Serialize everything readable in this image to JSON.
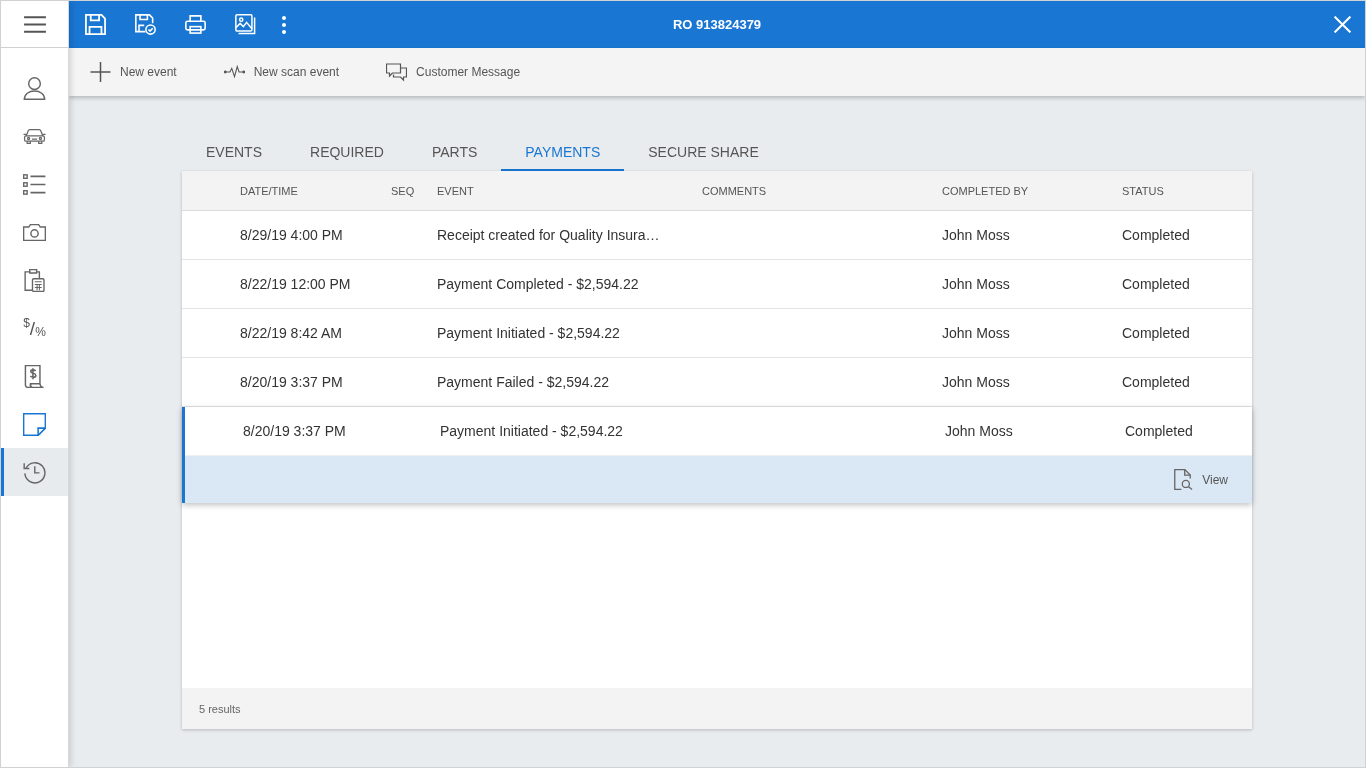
{
  "app_bar": {
    "title": "RO 913824379"
  },
  "sidebar": {
    "items": [
      {
        "kind": "person",
        "selected": false
      },
      {
        "kind": "car",
        "selected": false
      },
      {
        "kind": "checklist",
        "selected": false
      },
      {
        "kind": "camera",
        "selected": false
      },
      {
        "kind": "calculator",
        "selected": false
      },
      {
        "kind": "glyph",
        "text": "$/%",
        "selected": false
      },
      {
        "kind": "receipt",
        "selected": false
      },
      {
        "kind": "note",
        "selected": false
      },
      {
        "kind": "history",
        "selected": true
      }
    ]
  },
  "toolbar": {
    "buttons": [
      {
        "kind": "add",
        "label": "New event"
      },
      {
        "kind": "scan",
        "label": "New scan event"
      },
      {
        "kind": "message",
        "label": "Customer Message"
      }
    ]
  },
  "tabs": [
    {
      "label": "EVENTS",
      "selected": false
    },
    {
      "label": "REQUIRED",
      "selected": false
    },
    {
      "label": "PARTS",
      "selected": false
    },
    {
      "label": "PAYMENTS",
      "selected": true
    },
    {
      "label": "SECURE SHARE",
      "selected": false
    }
  ],
  "table": {
    "columns": [
      "DATE/TIME",
      "SEQ",
      "EVENT",
      "COMMENTS",
      "COMPLETED BY",
      "STATUS"
    ],
    "rows": [
      {
        "date_time": "8/29/19 4:00 PM",
        "event": "Receipt created for Quality Insura…",
        "completed_by": "John Moss",
        "status": "Completed",
        "selected": false,
        "expanded": false
      },
      {
        "date_time": "8/22/19 12:00 PM",
        "event": "Payment Completed - $2,594.22",
        "completed_by": "John Moss",
        "status": "Completed",
        "selected": false,
        "expanded": false
      },
      {
        "date_time": "8/22/19 8:42 AM",
        "event": "Payment Initiated - $2,594.22",
        "completed_by": "John Moss",
        "status": "Completed",
        "selected": false,
        "expanded": false
      },
      {
        "date_time": "8/20/19 3:37 PM",
        "event": "Payment Failed - $2,594.22",
        "completed_by": "John Moss",
        "status": "Completed",
        "selected": false,
        "expanded": false
      },
      {
        "date_time": "8/20/19 3:37 PM",
        "event": "Payment Initiated - $2,594.22",
        "completed_by": "John Moss",
        "status": "Completed",
        "selected": true,
        "expanded": true,
        "actions": [
          {
            "kind": "view",
            "label": "View"
          }
        ]
      }
    ],
    "footer": "5 results"
  }
}
